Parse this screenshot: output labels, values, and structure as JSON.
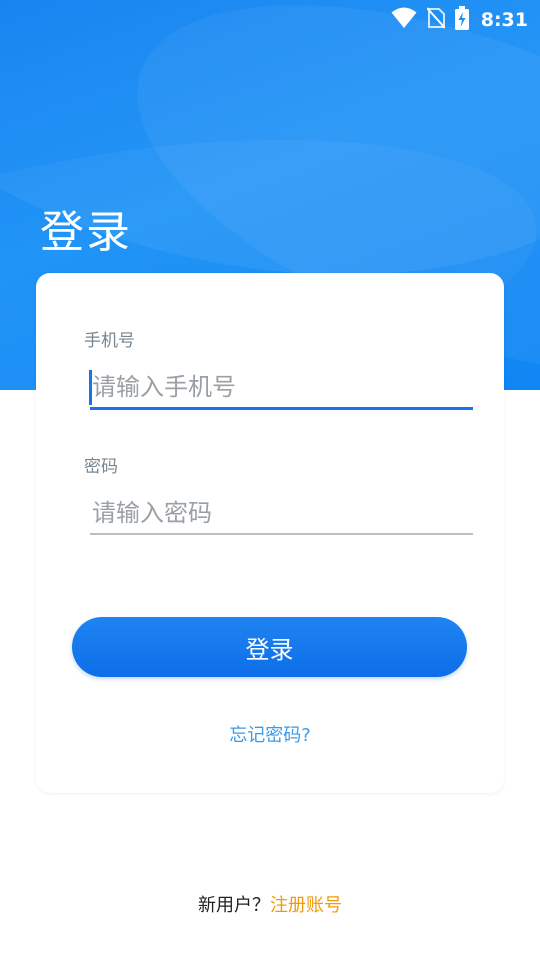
{
  "status_bar": {
    "time": "8:31",
    "icons": [
      "wifi-icon",
      "no-sim-icon",
      "battery-charging-icon"
    ]
  },
  "page": {
    "title": "登录"
  },
  "phone_field": {
    "label": "手机号",
    "placeholder": "请输入手机号",
    "value": ""
  },
  "password_field": {
    "label": "密码",
    "placeholder": "请输入密码",
    "value": ""
  },
  "actions": {
    "login_label": "登录",
    "forgot_label": "忘记密码?",
    "new_user_text": "新用户？",
    "register_label": "注册账号"
  },
  "colors": {
    "primary": "#1a73e8",
    "link": "#3c9be8",
    "register": "#f29a0a"
  }
}
